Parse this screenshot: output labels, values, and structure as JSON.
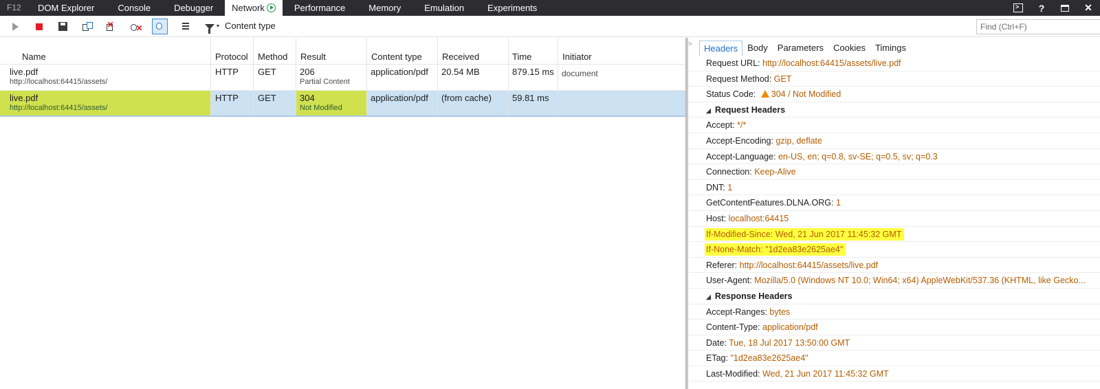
{
  "topbar": {
    "f12": "F12",
    "tabs": [
      "DOM Explorer",
      "Console",
      "Debugger",
      "Network",
      "Performance",
      "Memory",
      "Emulation",
      "Experiments"
    ],
    "window_controls": {
      "console": ">",
      "help": "?",
      "close": "✕"
    }
  },
  "toolbar": {
    "filter_label": "Content type",
    "find_placeholder": "Find (Ctrl+F)"
  },
  "table": {
    "columns": [
      "Name",
      "Protocol",
      "Method",
      "Result",
      "Content type",
      "Received",
      "Time",
      "Initiator"
    ],
    "rows": [
      {
        "name": "live.pdf",
        "path": "http://localhost:64415/assets/",
        "protocol": "HTTP",
        "method": "GET",
        "result": "206",
        "result_text": "Partial Content",
        "content_type": "application/pdf",
        "received": "20.54 MB",
        "time": "879.15 ms",
        "initiator": "document"
      },
      {
        "name": "live.pdf",
        "path": "http://localhost:64415/assets/",
        "protocol": "HTTP",
        "method": "GET",
        "result": "304",
        "result_text": "Not Modified",
        "content_type": "application/pdf",
        "received": "(from cache)",
        "time": "59.81 ms",
        "initiator": ""
      }
    ]
  },
  "details": {
    "collapse_glyph": ">",
    "tabs": [
      "Headers",
      "Body",
      "Parameters",
      "Cookies",
      "Timings"
    ],
    "general": [
      {
        "key": "Request URL: ",
        "value": "http://localhost:64415/assets/live.pdf"
      },
      {
        "key": "Request Method: ",
        "value": "GET"
      },
      {
        "key": "Status Code: ",
        "value": "304 / Not Modified"
      }
    ],
    "request_headers_title": "Request Headers",
    "request_headers": [
      {
        "key": "Accept: ",
        "value": "*/*"
      },
      {
        "key": "Accept-Encoding: ",
        "value": "gzip, deflate"
      },
      {
        "key": "Accept-Language: ",
        "value": "en-US, en; q=0.8, sv-SE; q=0.5, sv; q=0.3"
      },
      {
        "key": "Connection: ",
        "value": "Keep-Alive"
      },
      {
        "key": "DNT: ",
        "value": "1"
      },
      {
        "key": "GetContentFeatures.DLNA.ORG: ",
        "value": "1"
      },
      {
        "key": "Host: ",
        "value": "localhost:64415"
      },
      {
        "key": "If-Modified-Since: ",
        "value": "Wed, 21 Jun 2017 11:45:32 GMT"
      },
      {
        "key": "If-None-Match: ",
        "value": "\"1d2ea83e2625ae4\""
      },
      {
        "key": "Referer: ",
        "value": "http://localhost:64415/assets/live.pdf"
      },
      {
        "key": "User-Agent: ",
        "value": "Mozilla/5.0 (Windows NT 10.0; Win64; x64) AppleWebKit/537.36 (KHTML, like Gecko..."
      }
    ],
    "response_headers_title": "Response Headers",
    "response_headers": [
      {
        "key": "Accept-Ranges: ",
        "value": "bytes"
      },
      {
        "key": "Content-Type: ",
        "value": "application/pdf"
      },
      {
        "key": "Date: ",
        "value": "Tue, 18 Jul 2017 13:50:00 GMT"
      },
      {
        "key": "ETag: ",
        "value": "\"1d2ea83e2625ae4\""
      },
      {
        "key": "Last-Modified: ",
        "value": "Wed, 21 Jun 2017 11:45:32 GMT"
      }
    ]
  },
  "colors": {
    "selected_row": "#cce1f2",
    "highlight_green": "#cfe14f",
    "header_value": "#b35c00",
    "marker_yellow": "#ffff40",
    "warning": "#f08c00"
  }
}
